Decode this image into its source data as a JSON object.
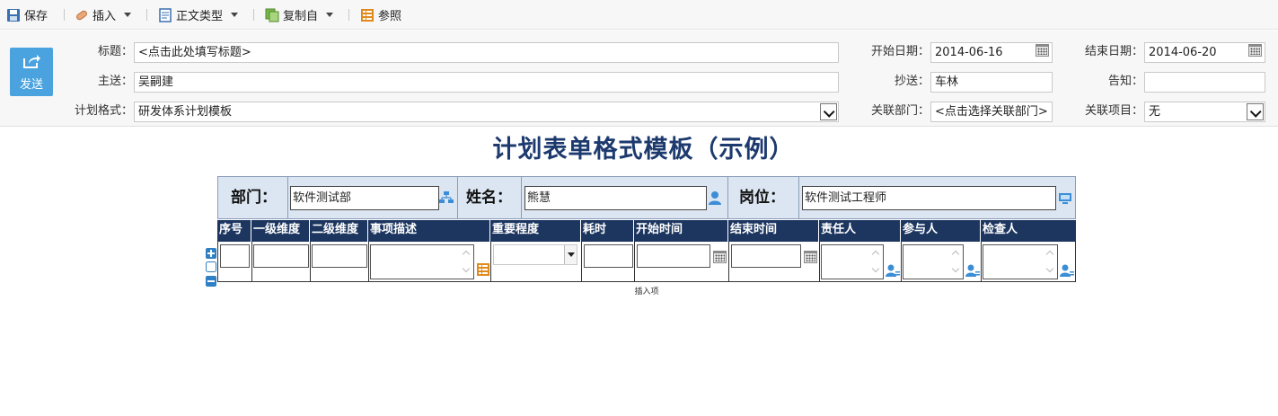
{
  "toolbar": {
    "save": "保存",
    "insert": "插入",
    "doc_type": "正文类型",
    "copy_from": "复制自",
    "reference": "参照"
  },
  "header": {
    "send": "发送",
    "title_label": "标题：",
    "title_value": "<点击此处填写标题>",
    "to_label": "主送：",
    "to_value": "吴嗣建",
    "format_label": "计划格式：",
    "format_value": "研发体系计划模板",
    "start_label": "开始日期：",
    "start_value": "2014-06-16",
    "end_label": "结束日期：",
    "end_value": "2014-06-20",
    "cc_label": "抄送：",
    "cc_value": "车林",
    "notify_label": "告知：",
    "notify_value": "",
    "dept_label": "关联部门：",
    "dept_value": "<点击选择关联部门>",
    "project_label": "关联项目：",
    "project_value": "无"
  },
  "doc": {
    "title": "计划表单格式模板（示例）",
    "dept_label": "部门：",
    "dept_value": "软件测试部",
    "name_label": "姓名：",
    "name_value": "熊慧",
    "post_label": "岗位：",
    "post_value": "软件测试工程师",
    "columns": [
      "序号",
      "一级维度",
      "二级维度",
      "事项描述",
      "重要程度",
      "耗时",
      "开始时间",
      "结束时间",
      "责任人",
      "参与人",
      "检查人"
    ],
    "insert_item": "插入项"
  },
  "colors": {
    "grid_header": "#1d3660",
    "title": "#1d3a6e",
    "send_button": "#4aa3df",
    "info_bg": "#dce6f2"
  }
}
